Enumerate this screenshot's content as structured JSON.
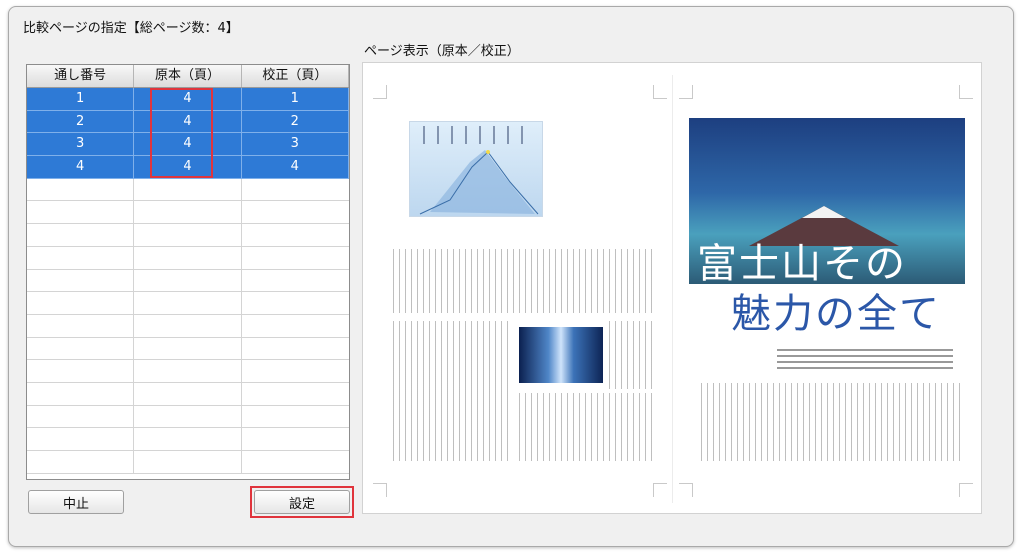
{
  "dialog": {
    "title": "比較ページの指定【総ページ数：4】"
  },
  "table": {
    "headers": [
      "通し番号",
      "原本（頁）",
      "校正（頁）"
    ],
    "rows": [
      [
        "1",
        "4",
        "1"
      ],
      [
        "2",
        "4",
        "2"
      ],
      [
        "3",
        "4",
        "3"
      ],
      [
        "4",
        "4",
        "4"
      ]
    ],
    "empty_rows": 13
  },
  "buttons": {
    "cancel_label": "中止",
    "set_label": "設定"
  },
  "preview": {
    "label": "ページ表示（原本／校正）",
    "title_line1": "富士山その",
    "title_line2": "魅力の全て"
  },
  "colors": {
    "selection": "#2e7ad6",
    "highlight": "#e0343c"
  }
}
